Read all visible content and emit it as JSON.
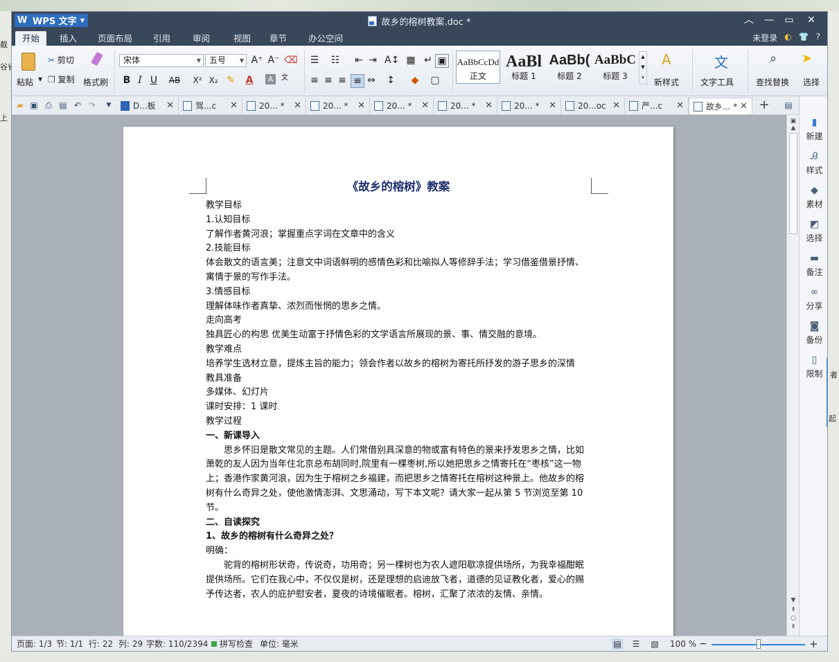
{
  "desktop": {
    "left_fragments": [
      "截",
      "谷雀",
      "上"
    ],
    "right_fragments": [
      "者",
      "起"
    ]
  },
  "titlebar": {
    "app_menu_label": "WPS 文字",
    "doc_title": "故乡的榕树教案.doc *"
  },
  "menu": {
    "tabs": [
      "开始",
      "插入",
      "页面布局",
      "引用",
      "审阅",
      "视图",
      "章节",
      "办公空间"
    ],
    "active_tab": "开始",
    "login": "未登录",
    "help": "?"
  },
  "ribbon": {
    "paste": "粘贴",
    "cut": "剪切",
    "copy": "复制",
    "format_painter": "格式刷",
    "font_name": "宋体",
    "font_size": "五号",
    "bold": "B",
    "italic": "I",
    "underline": "U",
    "strike": "AB",
    "superscript": "X²",
    "subscript": "X₂",
    "styles": [
      {
        "sample": "AaBbCcDd",
        "name": "正文"
      },
      {
        "sample": "AaBl",
        "name": "标题 1"
      },
      {
        "sample": "AaBb(",
        "name": "标题 2"
      },
      {
        "sample": "AaBbC",
        "name": "标题 3"
      }
    ],
    "new_style": "新样式",
    "text_tools": "文字工具",
    "find_replace": "查找替换",
    "select": "选择"
  },
  "doc_tabs": [
    {
      "label": "D...板"
    },
    {
      "label": "驾...c"
    },
    {
      "label": "20... *"
    },
    {
      "label": "20... *"
    },
    {
      "label": "20... *"
    },
    {
      "label": "20... *"
    },
    {
      "label": "20... *"
    },
    {
      "label": "20...oc"
    },
    {
      "label": "严...c"
    },
    {
      "label": "故乡... *"
    }
  ],
  "document": {
    "heading": "《故乡的榕树》教案",
    "paragraphs": [
      {
        "text": "教学目标",
        "style": ""
      },
      {
        "text": "1.认知目标",
        "style": ""
      },
      {
        "text": "了解作者黄河浪；掌握重点字词在文章中的含义",
        "style": ""
      },
      {
        "text": "2.技能目标",
        "style": ""
      },
      {
        "text": "体会散文的语言美；注意文中词语鲜明的感情色彩和比喻拟人等修辞手法；学习借鉴借景抒情、寓情于景的写作手法。",
        "style": ""
      },
      {
        "text": "3.情感目标",
        "style": ""
      },
      {
        "text": "理解体味作者真挚、浓烈而怅惘的思乡之情。",
        "style": ""
      },
      {
        "text": "走向高考",
        "style": ""
      },
      {
        "text": "独具匠心的构思 优美生动富于抒情色彩的文学语言所展现的景、事、情交融的意境。",
        "style": ""
      },
      {
        "text": "教学难点",
        "style": ""
      },
      {
        "text": "培养学生选材立意，提炼主旨的能力；领会作者以故乡的榕树为寄托所抒发的游子思乡的深情",
        "style": ""
      },
      {
        "text": "教具准备",
        "style": ""
      },
      {
        "text": "多媒体、幻灯片",
        "style": ""
      },
      {
        "text": "课时安排：1 课时",
        "style": ""
      },
      {
        "text": "教学过程",
        "style": ""
      },
      {
        "text": "一、新课导入",
        "style": "b"
      },
      {
        "text": "思乡怀旧是散文常见的主题。人们常借别具深意的物或富有特色的景来抒发思乡之情，比如萧乾的友人因为当年住北京总布胡同时,院里有一棵枣树,所以她把思乡之情寄托在“枣核”这一物上；香港作家黄河浪，因为生于榕树之乡福建，而把思乡之情寄托在榕树这种景上。他故乡的榕树有什么奇异之处，使他激情澎湃、文思涌动，写下本文呢？请大家一起从第 5 节浏览至第 10 节。",
        "style": "ind"
      },
      {
        "text": "二、自读探究",
        "style": "b"
      },
      {
        "text": "1、故乡的榕树有什么奇异之处？",
        "style": "b"
      },
      {
        "text": "明确：",
        "style": ""
      },
      {
        "text": "驼背的榕树形状奇，传说奇，功用奇；另一棵树也为农人遮阳歇凉提供场所，为我幸福酣眠提供场所。它们在我心中，不仅仅是树，还是理想的启迪放飞者，道德的见证教化者，爱心的赐予传达者，农人的庇护慰安者，夏夜的诗境催眠者。榕树，汇聚了浓浓的友情、亲情。",
        "style": "ind"
      }
    ]
  },
  "sidepane": [
    "新建",
    "样式",
    "素材",
    "选择",
    "备注",
    "分享",
    "备份",
    "限制"
  ],
  "status": {
    "page": "页面: 1/3",
    "section": "节: 1/1",
    "row": "行: 22",
    "col": "列: 29",
    "words": "字数: 110/2394",
    "spell": "拼写检查",
    "unit": "单位: 毫米",
    "zoom": "100 %",
    "zoom_level": 0.5
  }
}
